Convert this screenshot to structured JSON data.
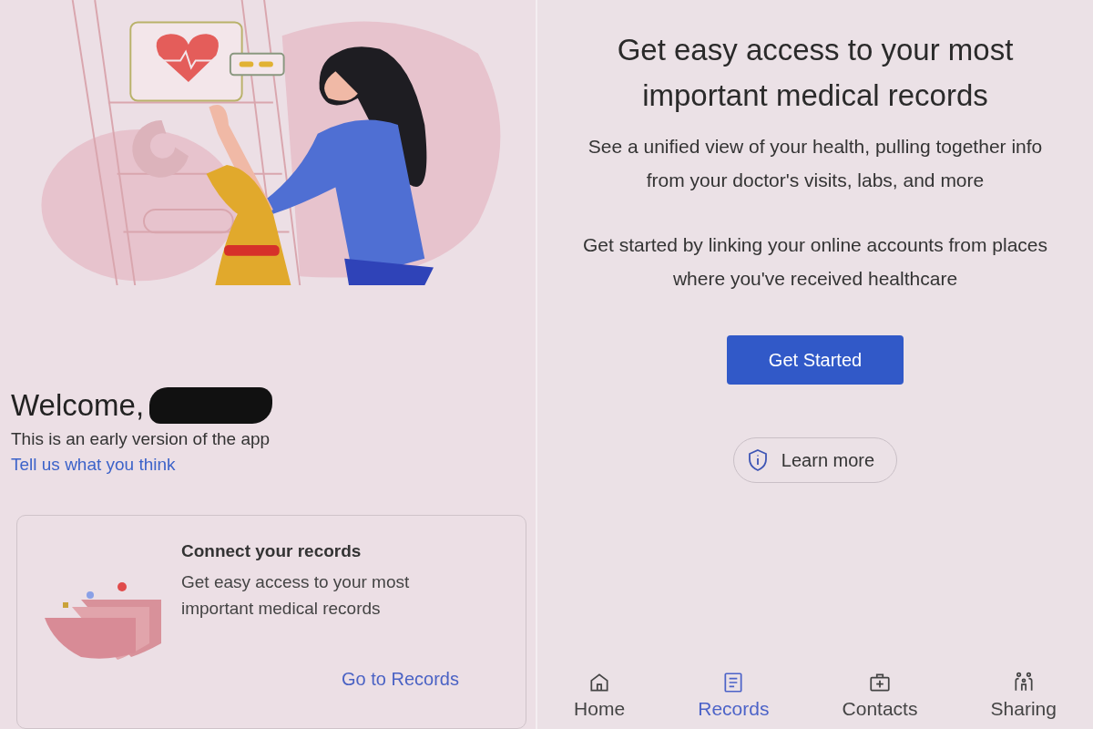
{
  "welcome": {
    "greeting": "Welcome,",
    "subtitle": "This is an early version of the app",
    "feedback_link": "Tell us what you think"
  },
  "records_card": {
    "title": "Connect your records",
    "description": "Get easy access to your most important medical records",
    "action": "Go to Records"
  },
  "intro": {
    "title": "Get easy access to your most important medical records",
    "paragraphs": [
      "See a unified view of your health, pulling together info from your doctor's visits, labs, and more",
      "Get started by linking your online accounts from places where you've received healthcare"
    ],
    "primary_button": "Get Started",
    "secondary_button": "Learn more"
  },
  "nav": [
    {
      "label": "Home",
      "kind": "home",
      "selected": false
    },
    {
      "label": "Records",
      "kind": "records",
      "selected": true
    },
    {
      "label": "Contacts",
      "kind": "contacts",
      "selected": false
    },
    {
      "label": "Sharing",
      "kind": "sharing",
      "selected": false
    }
  ]
}
